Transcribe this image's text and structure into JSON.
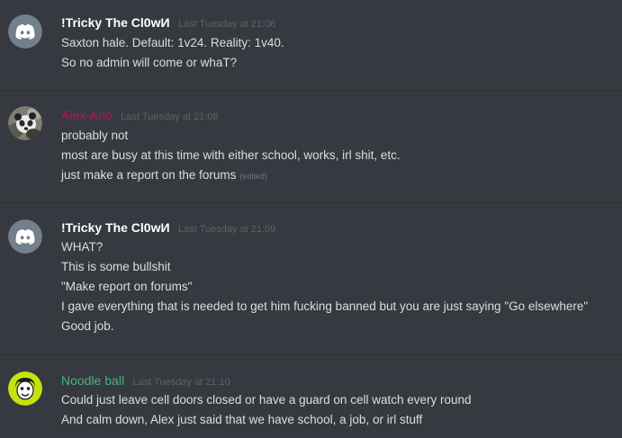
{
  "messages": [
    {
      "username": "!Tricky The Cl0wИ",
      "username_color": "#ffffff",
      "avatar": "discord-default-avatar",
      "timestamp": "Last Tuesday at 21:06",
      "lines": [
        "Saxton hale. Default: 1v24. Reality: 1v40.",
        "So no admin will come or whaT?"
      ]
    },
    {
      "username": "Alex-Ario",
      "username_color": "#b3185a",
      "avatar": "panda-avatar",
      "timestamp": "Last Tuesday at 21:08",
      "lines": [
        "probably not",
        "most are busy at this time with either school, works, irl shit, etc.",
        "just make a report on the forums"
      ],
      "edited_label": "(edited)"
    },
    {
      "username": "!Tricky The Cl0wИ",
      "username_color": "#ffffff",
      "avatar": "discord-default-avatar",
      "timestamp": "Last Tuesday at 21:09",
      "lines": [
        "WHAT?",
        "This is some bullshit",
        "\"Make report on forums\"",
        "I gave everything that is needed to get him fucking banned but you are just saying \"Go elsewhere\"",
        "Good job."
      ]
    },
    {
      "username": "Noodle ball",
      "username_color": "#43b581",
      "avatar": "cartoon-face-avatar",
      "timestamp": "Last Tuesday at 21:10",
      "lines": [
        "Could just leave cell doors closed or have a guard on cell watch every round",
        "And calm down, Alex just said that we have school, a job, or irl stuff"
      ]
    }
  ],
  "colors": {
    "background": "#36393f",
    "divider": "#2f3136",
    "message_text": "#dcddde",
    "timestamp": "#5f6167",
    "discord_avatar_bg": "#747f8d",
    "noodle_avatar_bg": "#c6e20f"
  }
}
